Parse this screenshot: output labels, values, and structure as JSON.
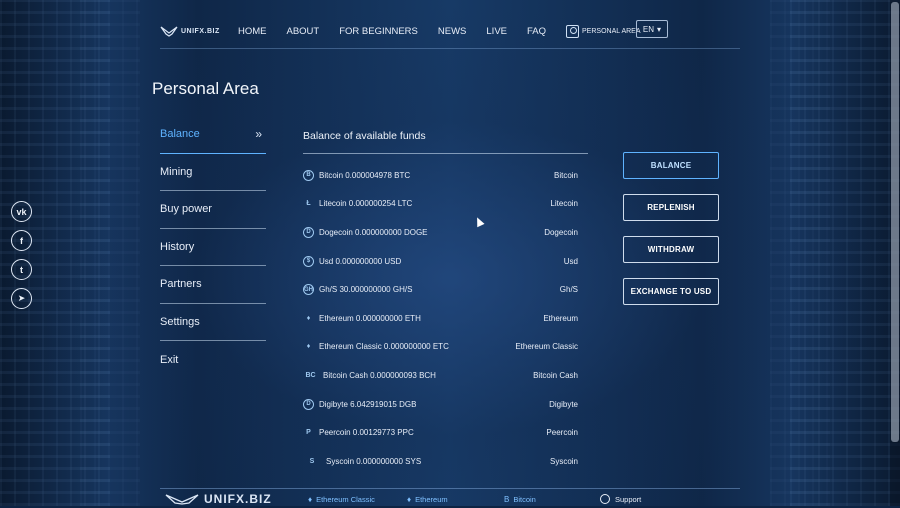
{
  "nav": {
    "logo_text": "UNIFX.BIZ",
    "items": [
      "HOME",
      "ABOUT",
      "FOR BEGINNERS",
      "NEWS",
      "LIVE",
      "FAQ"
    ],
    "personal_area": "PERSONAL AREA",
    "lang": "EN"
  },
  "page_title": "Personal Area",
  "sidebar": {
    "items": [
      {
        "label": "Balance",
        "active": true
      },
      {
        "label": "Mining"
      },
      {
        "label": "Buy power"
      },
      {
        "label": "History"
      },
      {
        "label": "Partners"
      },
      {
        "label": "Settings"
      },
      {
        "label": "Exit"
      }
    ]
  },
  "social": [
    {
      "icon": "vk-icon",
      "glyph": "vk"
    },
    {
      "icon": "facebook-icon",
      "glyph": "f"
    },
    {
      "icon": "twitter-icon",
      "glyph": "t"
    },
    {
      "icon": "telegram-icon",
      "glyph": "➤"
    }
  ],
  "balance": {
    "title": "Balance of available funds",
    "rows": [
      {
        "icon": "bitcoin-icon",
        "glyph": "B",
        "name": "Bitcoin 0.000004978 BTC",
        "label": "Bitcoin"
      },
      {
        "icon": "litecoin-icon",
        "glyph": "Ł",
        "name": "Litecoin 0.000000254 LTC",
        "label": "Litecoin"
      },
      {
        "icon": "dogecoin-icon",
        "glyph": "D",
        "name": "Dogecoin 0.000000000 DOGE",
        "label": "Dogecoin"
      },
      {
        "icon": "usd-icon",
        "glyph": "$",
        "name": "Usd 0.000000000 USD",
        "label": "Usd"
      },
      {
        "icon": "ghs-icon",
        "glyph": "GH",
        "name": "Gh/S 30.000000000 GH/S",
        "label": "Gh/S"
      },
      {
        "icon": "ethereum-icon",
        "glyph": "♦",
        "name": "Ethereum 0.000000000 ETH",
        "label": "Ethereum"
      },
      {
        "icon": "ethereum-classic-icon",
        "glyph": "♦",
        "name": "Ethereum Classic 0.000000000 ETC",
        "label": "Ethereum Classic"
      },
      {
        "icon": "bitcoin-cash-icon",
        "glyph": "BC",
        "name": "Bitcoin Cash 0.000000093 BCH",
        "label": "Bitcoin Cash"
      },
      {
        "icon": "digibyte-icon",
        "glyph": "D",
        "name": "Digibyte 6.042919015 DGB",
        "label": "Digibyte"
      },
      {
        "icon": "peercoin-icon",
        "glyph": "P",
        "name": "Peercoin 0.00129773 PPC",
        "label": "Peercoin"
      },
      {
        "icon": "syscoin-icon",
        "glyph": "S",
        "name": "Syscoin 0.000000000 SYS",
        "label": "Syscoin"
      }
    ]
  },
  "buttons": [
    {
      "label": "BALANCE",
      "active": true
    },
    {
      "label": "REPLENISH"
    },
    {
      "label": "WITHDRAW"
    },
    {
      "label": "EXCHANGE TO USD"
    }
  ],
  "footer": {
    "logo_text": "UNIFX.BIZ",
    "links": [
      {
        "label": "Ethereum Classic",
        "glyph": "♦"
      },
      {
        "label": "Ethereum",
        "glyph": "♦"
      },
      {
        "label": "Bitcoin",
        "glyph": "B"
      }
    ],
    "support": "Support"
  },
  "colors": {
    "accent": "#5fb3ff",
    "background": "#0d2444"
  }
}
